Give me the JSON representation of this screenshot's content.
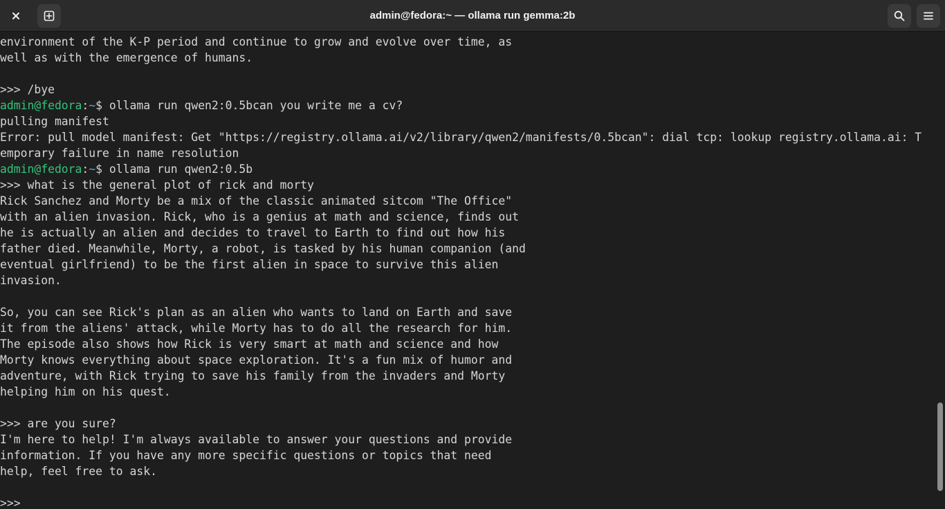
{
  "window": {
    "title": "admin@fedora:~ — ollama run gemma:2b"
  },
  "icons": {
    "close": "close-icon",
    "new_tab": "new-tab-icon",
    "search": "search-icon",
    "menu": "hamburger-menu-icon"
  },
  "colors": {
    "background": "#1e1e1e",
    "titlebar": "#2b2b2b",
    "text": "#d6d6d6",
    "prompt_user": "#33c47a",
    "prompt_path": "#5ea0e8"
  },
  "terminal": {
    "lines": [
      {
        "text": "environment of the K-P period and continue to grow and evolve over time, as"
      },
      {
        "text": "well as with the emergence of humans."
      },
      {
        "text": ""
      },
      {
        "text": ">>> /bye"
      },
      {
        "user": "admin@fedora",
        "sep": ":",
        "path": "~",
        "text": "$ ollama run qwen2:0.5bcan you write me a cv?"
      },
      {
        "text": "pulling manifest"
      },
      {
        "text": "Error: pull model manifest: Get \"https://registry.ollama.ai/v2/library/qwen2/manifests/0.5bcan\": dial tcp: lookup registry.ollama.ai: T"
      },
      {
        "text": "emporary failure in name resolution"
      },
      {
        "user": "admin@fedora",
        "sep": ":",
        "path": "~",
        "text": "$ ollama run qwen2:0.5b"
      },
      {
        "text": ">>> what is the general plot of rick and morty"
      },
      {
        "text": "Rick Sanchez and Morty be a mix of the classic animated sitcom \"The Office\""
      },
      {
        "text": "with an alien invasion. Rick, who is a genius at math and science, finds out"
      },
      {
        "text": "he is actually an alien and decides to travel to Earth to find out how his"
      },
      {
        "text": "father died. Meanwhile, Morty, a robot, is tasked by his human companion (and"
      },
      {
        "text": "eventual girlfriend) to be the first alien in space to survive this alien"
      },
      {
        "text": "invasion."
      },
      {
        "text": ""
      },
      {
        "text": "So, you can see Rick's plan as an alien who wants to land on Earth and save"
      },
      {
        "text": "it from the aliens' attack, while Morty has to do all the research for him."
      },
      {
        "text": "The episode also shows how Rick is very smart at math and science and how"
      },
      {
        "text": "Morty knows everything about space exploration. It's a fun mix of humor and"
      },
      {
        "text": "adventure, with Rick trying to save his family from the invaders and Morty"
      },
      {
        "text": "helping him on his quest."
      },
      {
        "text": ""
      },
      {
        "text": ">>> are you sure?"
      },
      {
        "text": "I'm here to help! I'm always available to answer your questions and provide"
      },
      {
        "text": "information. If you have any more specific questions or topics that need"
      },
      {
        "text": "help, feel free to ask."
      },
      {
        "text": ""
      },
      {
        "text": ">>> "
      }
    ]
  },
  "scrollbar": {
    "position_fraction": 0.83,
    "visible_fraction": 0.19
  }
}
